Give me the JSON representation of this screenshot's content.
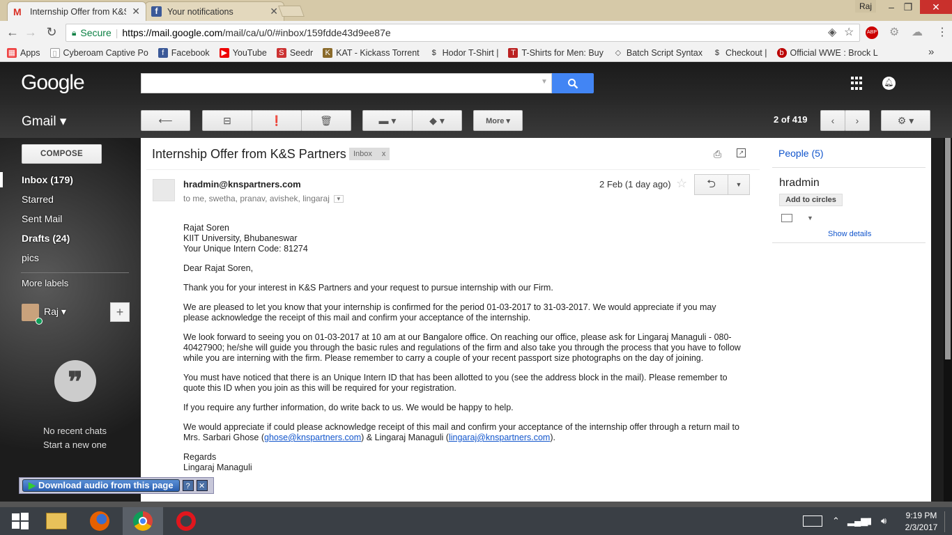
{
  "browser": {
    "tabs": [
      {
        "title": "Internship Offer from K&S",
        "active": true
      },
      {
        "title": "Your notifications",
        "active": false
      }
    ],
    "profile": "Raj",
    "window_controls": {
      "min": "–",
      "max": "❐",
      "close": "✕"
    },
    "security_label": "Secure",
    "url_host": "https://mail.google.com",
    "url_path": "/mail/ca/u/0/#inbox/159fdde43d9ee87e",
    "bookmarks": [
      {
        "label": "Apps",
        "icon": "apps-icon",
        "color": "#e44"
      },
      {
        "label": "Cyberoam Captive Po",
        "icon": "page-icon",
        "color": "#999"
      },
      {
        "label": "Facebook",
        "icon": "facebook-icon",
        "color": "#3b5998"
      },
      {
        "label": "YouTube",
        "icon": "youtube-icon",
        "color": "#e00"
      },
      {
        "label": "Seedr",
        "icon": "seedr-icon",
        "color": "#c33"
      },
      {
        "label": "KAT - Kickass Torrent",
        "icon": "kat-icon",
        "color": "#8a6a2a"
      },
      {
        "label": "Hodor T-Shirt |",
        "icon": "dollar-icon",
        "color": "#333"
      },
      {
        "label": "T-Shirts for Men: Buy",
        "icon": "tshirt-icon",
        "color": "#b22"
      },
      {
        "label": "Batch Script Syntax",
        "icon": "diamond-icon",
        "color": "#555"
      },
      {
        "label": "Checkout |",
        "icon": "dollar-icon",
        "color": "#333"
      },
      {
        "label": "Official WWE : Brock L",
        "icon": "wwe-icon",
        "color": "#b00"
      }
    ],
    "more_bookmarks": "»"
  },
  "gmail": {
    "logo": "Google",
    "app_label": "Gmail ▾",
    "more_button": "More ▾",
    "page_count_current": "2",
    "page_count_text": " of 419",
    "compose": "COMPOSE",
    "nav": [
      {
        "label": "Inbox (179)",
        "bold": true
      },
      {
        "label": "Starred",
        "bold": false
      },
      {
        "label": "Sent Mail",
        "bold": false
      },
      {
        "label": "Drafts (24)",
        "bold": true
      },
      {
        "label": "pics",
        "bold": false
      }
    ],
    "more_labels": "More labels",
    "user": "Raj ▾",
    "add_button": "+",
    "hangouts_icon": "❞",
    "no_recent_chats": "No recent chats",
    "start_new": "Start a new one"
  },
  "email": {
    "subject": "Internship Offer from K&S Partners",
    "tag": "Inbox",
    "tag_close": "x",
    "sender": "hradmin@knspartners.com",
    "recipients": "to me, swetha, pranav, avishek, lingaraj",
    "date": "2 Feb (1 day ago)",
    "address_lines": [
      "Rajat Soren",
      "KIIT University, Bhubaneswar",
      "Your Unique Intern Code: 81274"
    ],
    "greeting": "Dear Rajat Soren,",
    "p1": "Thank you for your interest in K&S Partners and your request to pursue internship with our Firm.",
    "p2": "We are pleased to let you know that your internship is confirmed for the period 01-03-2017 to 31-03-2017. We would appreciate if you may please acknowledge the receipt of this mail and confirm your acceptance of the internship.",
    "p3": "We look forward to seeing you on 01-03-2017 at 10 am at our Bangalore office. On reaching our office, please ask for Lingaraj Managuli - 080-40427900; he/she will guide you through the basic rules and regulations of the firm and also take you through the process that you have to follow while you are interning with the firm. Please remember to carry a couple of your recent passport size photographs on the day of joining.",
    "p4": "You must have noticed that there is an Unique Intern ID that has been allotted to you (see the address block in the mail). Please remember to quote this ID when you join as this will be required for your registration.",
    "p5": "If you require any further information, do write back to us. We would be happy to help.",
    "p6_a": "We would appreciate if could please acknowledge receipt of this mail and confirm your acceptance of the internship offer through a return mail to Mrs. Sarbari Ghose (",
    "link1": "ghose@knspartners.com",
    "p6_b": ") & Lingaraj Managuli (",
    "link2": "lingaraj@knspartners.com",
    "p6_c": ").",
    "regards": "Regards",
    "signoff": "Lingaraj Managuli"
  },
  "people": {
    "header": "People (5)",
    "name": "hradmin",
    "add_circles": "Add to circles",
    "show_details": "Show details"
  },
  "audio_bar": {
    "label": "Download audio from this page",
    "help": "?",
    "close": "✕"
  },
  "taskbar": {
    "time": "9:19 PM",
    "date": "2/3/2017"
  }
}
